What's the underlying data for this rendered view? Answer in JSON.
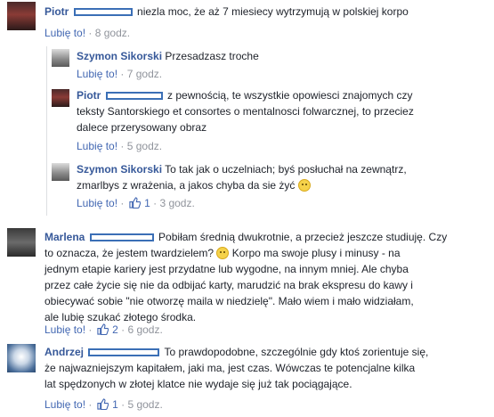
{
  "comments": [
    {
      "author": "Piotr",
      "text": "niezla moc, że aż 7 miesiecy wytrzymują w polskiej korpo",
      "like_label": "Lubię to!",
      "separator": "·",
      "time": "8 godz.",
      "avatar_icon": "profile-photo-dark-sunset"
    },
    {
      "author": "Szymon Sikorski",
      "text": "Przesadzasz troche",
      "like_label": "Lubię to!",
      "separator": "·",
      "time": "7 godz.",
      "avatar_icon": "profile-photo-person"
    },
    {
      "author": "Piotr",
      "line1": "z pewnością, te wszystkie opowiesci znajomych czy",
      "line2": "teksty Santorskiego et consortes o mentalnosci folwarcznej, to przeciez",
      "line3": "dalece przerysowany obraz",
      "like_label": "Lubię to!",
      "separator": "·",
      "time": "5 godz.",
      "avatar_icon": "profile-photo-dark-sunset"
    },
    {
      "author": "Szymon Sikorski",
      "line1": "To tak jak o uczelniach; byś posłuchał na zewnątrz,",
      "line2": "zmarlbys z wrażenia, a jakos chyba da sie żyć",
      "like_label": "Lubię to!",
      "separator": "·",
      "like_count": "1",
      "time": "3 godz.",
      "avatar_icon": "profile-photo-person"
    },
    {
      "author": "Marlena",
      "line1": "Pobiłam średnią dwukrotnie, a przecież jeszcze studiuję. Czy",
      "line2a": "to oznacza, że jestem twardzielem?",
      "line2b": "Korpo ma swoje plusy i minusy - na",
      "line3": "jednym etapie kariery jest przydatne lub wygodne, na innym mniej. Ale chyba",
      "line4": "przez całe życie się nie da odbijać karty, marudzić na brak ekspresu do kawy i",
      "line5": "obiecywać sobie \"nie otworzę maila w niedzielę\". Mało wiem i mało widziałam,",
      "line6": "ale lubię szukać złotego środka.",
      "like_label": "Lubię to!",
      "separator": "·",
      "like_count": "2",
      "time": "6 godz.",
      "avatar_icon": "profile-photo-woman"
    },
    {
      "author": "Andrzej",
      "line1": "To prawdopodobne, szczególnie gdy ktoś zorientuje się,",
      "line2": "że najwazniejszym kapitałem, jaki ma, jest czas. Wówczas te potencjalne kilka",
      "line3": "lat spędzonych w złotej klatce nie wydaje się już tak pociągające.",
      "like_label": "Lubię to!",
      "separator": "·",
      "like_count": "1",
      "time": "5 godz.",
      "avatar_icon": "profile-photo-sketch-face"
    }
  ]
}
